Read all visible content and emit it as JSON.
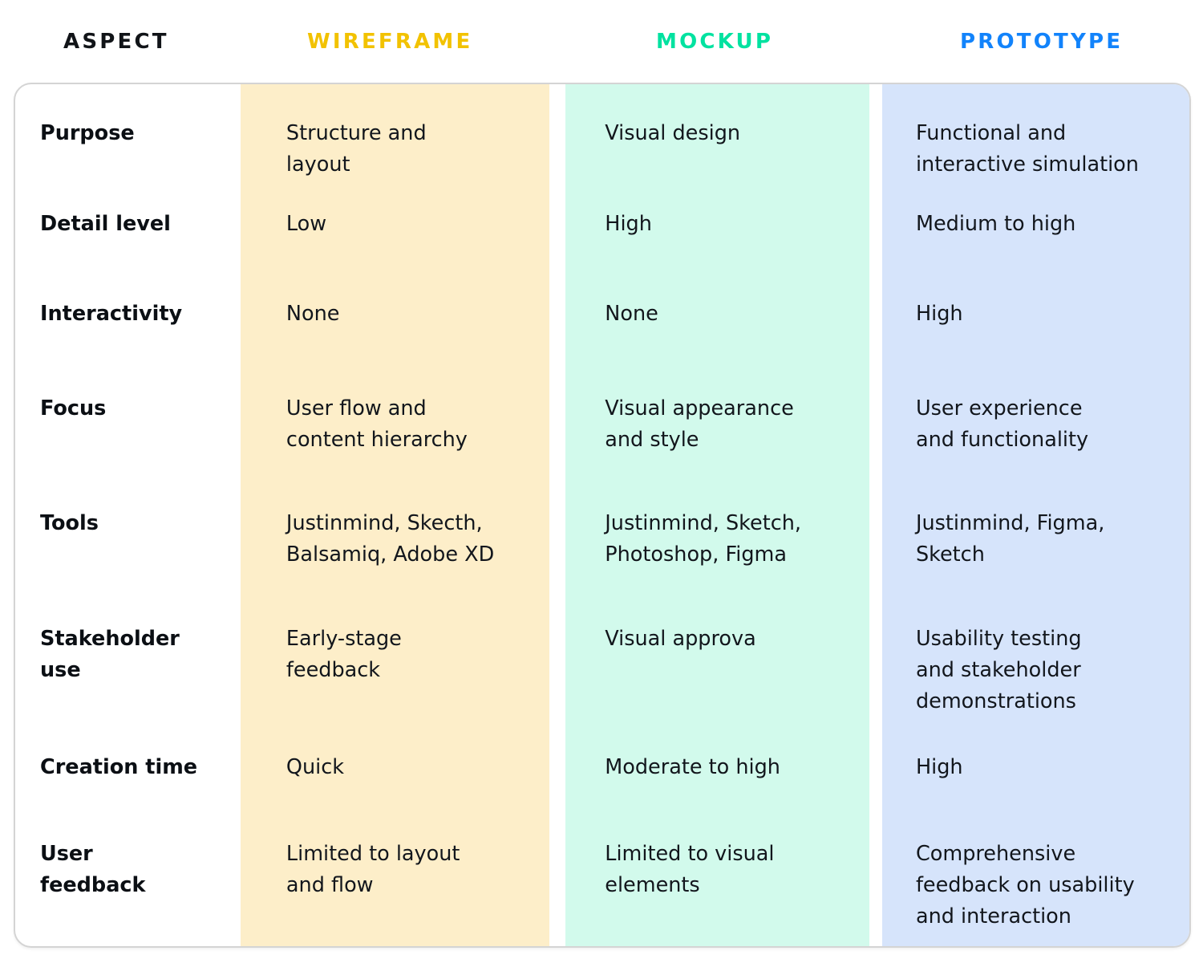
{
  "table": {
    "headers": [
      {
        "label": "ASPECT",
        "color": "#111418"
      },
      {
        "label": "WIREFRAME",
        "color": "#f2c200"
      },
      {
        "label": "MOCKUP",
        "color": "#00e2a0"
      },
      {
        "label": "PROTOTYPE",
        "color": "#1283fb"
      }
    ],
    "column_colors": {
      "aspect": "#ffffff",
      "wireframe": "#fdeec9",
      "mockup": "#d2faec",
      "prototype": "#d6e4fb"
    },
    "border_color": "#d4d4d4",
    "rows": [
      {
        "aspect": "Purpose",
        "wireframe": "Structure and\nlayout",
        "mockup": "Visual design",
        "prototype": "Functional and\ninteractive simulation"
      },
      {
        "aspect": "Detail level",
        "wireframe": "Low",
        "mockup": "High",
        "prototype": "Medium to high"
      },
      {
        "aspect": "Interactivity",
        "wireframe": "None",
        "mockup": "None",
        "prototype": "High"
      },
      {
        "aspect": "Focus",
        "wireframe": "User flow and\ncontent hierarchy",
        "mockup": "Visual appearance\nand style",
        "prototype": "User experience\nand functionality"
      },
      {
        "aspect": "Tools",
        "wireframe": "Justinmind, Skecth,\nBalsamiq,  Adobe XD",
        "mockup": "Justinmind, Sketch,\nPhotoshop, Figma",
        "prototype": "Justinmind, Figma,\nSketch"
      },
      {
        "aspect": "Stakeholder\nuse",
        "wireframe": "Early-stage\nfeedback",
        "mockup": "Visual approva",
        "prototype": "Usability testing\nand stakeholder\ndemonstrations"
      },
      {
        "aspect": "Creation time",
        "wireframe": "Quick",
        "mockup": "Moderate to high",
        "prototype": "High"
      },
      {
        "aspect": "User\nfeedback",
        "wireframe": "Limited to layout\nand flow",
        "mockup": "Limited to visual\nelements",
        "prototype": "Comprehensive\nfeedback on usability\nand interaction"
      }
    ]
  }
}
